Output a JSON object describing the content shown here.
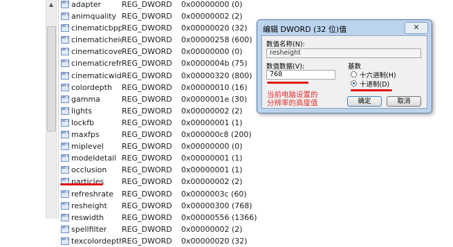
{
  "value_list": [
    {
      "name": "adapter",
      "type": "REG_DWORD",
      "value": "0x00000000 (0)"
    },
    {
      "name": "animquality",
      "type": "REG_DWORD",
      "value": "0x00000002 (2)"
    },
    {
      "name": "cinematicbpp",
      "type": "REG_DWORD",
      "value": "0x00000020 (32)"
    },
    {
      "name": "cinematicheight",
      "type": "REG_DWORD",
      "value": "0x00000258 (600)"
    },
    {
      "name": "cinematicoverr...",
      "type": "REG_DWORD",
      "value": "0x00000000 (0)"
    },
    {
      "name": "cinematicrefresh",
      "type": "REG_DWORD",
      "value": "0x0000004b (75)"
    },
    {
      "name": "cinematicwidth",
      "type": "REG_DWORD",
      "value": "0x00000320 (800)"
    },
    {
      "name": "colordepth",
      "type": "REG_DWORD",
      "value": "0x00000010 (16)"
    },
    {
      "name": "gamma",
      "type": "REG_DWORD",
      "value": "0x0000001e (30)"
    },
    {
      "name": "lights",
      "type": "REG_DWORD",
      "value": "0x00000002 (2)"
    },
    {
      "name": "lockfb",
      "type": "REG_DWORD",
      "value": "0x00000001 (1)"
    },
    {
      "name": "maxfps",
      "type": "REG_DWORD",
      "value": "0x000000c8 (200)"
    },
    {
      "name": "miplevel",
      "type": "REG_DWORD",
      "value": "0x00000000 (0)"
    },
    {
      "name": "modeldetail",
      "type": "REG_DWORD",
      "value": "0x00000001 (1)"
    },
    {
      "name": "occlusion",
      "type": "REG_DWORD",
      "value": "0x00000001 (1)"
    },
    {
      "name": "particles",
      "type": "REG_DWORD",
      "value": "0x00000002 (2)"
    },
    {
      "name": "refreshrate",
      "type": "REG_DWORD",
      "value": "0x0000003c (60)"
    },
    {
      "name": "resheight",
      "type": "REG_DWORD",
      "value": "0x00000300 (768)"
    },
    {
      "name": "reswidth",
      "type": "REG_DWORD",
      "value": "0x00000556 (1366)"
    },
    {
      "name": "spellfilter",
      "type": "REG_DWORD",
      "value": "0x00000002 (2)"
    },
    {
      "name": "texcolordepth",
      "type": "REG_DWORD",
      "value": "0x00000020 (32)"
    }
  ],
  "icon_text": "ab\n110",
  "dialog": {
    "title": "编辑 DWORD (32 位)值",
    "close_label": "✕",
    "name_label": "数值名称(N):",
    "name_value": "resheight",
    "data_label": "数值数据(V):",
    "data_value": "768",
    "base_label": "基数",
    "hex_label": "十六进制(H)",
    "dec_label": "十进制(D)",
    "ok_label": "确定",
    "cancel_label": "取消"
  },
  "annotation": "当前电脑设置的分辨率的高度值",
  "colors": {
    "annotation": "#e23030",
    "dialog_frame": "#bcd3ee"
  }
}
